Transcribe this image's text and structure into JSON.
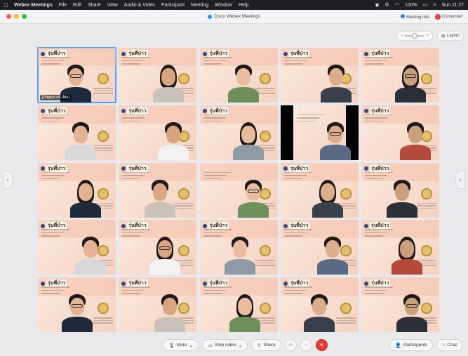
{
  "menubar": {
    "apple": "",
    "app": "Webex Meetings",
    "items": [
      "File",
      "Edit",
      "Share",
      "View",
      "Audio & Video",
      "Participant",
      "Meeting",
      "Window",
      "Help"
    ],
    "battery": "100%",
    "clock": "Sun 11:27"
  },
  "window": {
    "title": "Cisco Webex Meetings",
    "meeting_info": "Meeting Info",
    "connected": "Connected"
  },
  "view": {
    "layout_label": "Layout"
  },
  "tiles": [
    {
      "sticker": "รุ่นพี่ป่าว",
      "label": "[Pnipun #4 (Me)",
      "active": true
    },
    {
      "sticker": "รุ่นพี่ป่าว"
    },
    {
      "sticker": "รุ่นพี่ป่าว"
    },
    {
      "sticker": "รุ่นพี่ป่าว"
    },
    {
      "sticker": "รุ่นพี่ป่าว"
    },
    {
      "sticker": "รุ่นพี่ป่าว"
    },
    {
      "sticker": "รุ่นพี่ป่าว"
    },
    {
      "sticker": "รุ่นพี่ป่าว"
    },
    {
      "sticker": "",
      "black": true
    },
    {
      "sticker": "รุ่นพี่ป่าว"
    },
    {
      "sticker": "รุ่นพี่ป่าว"
    },
    {
      "sticker": "รุ่นพี่ป่าว"
    },
    {
      "sticker": ""
    },
    {
      "sticker": "รุ่นพี่ป่าว"
    },
    {
      "sticker": "รุ่นพี่ป่าว"
    },
    {
      "sticker": "รุ่นพี่ป่าว"
    },
    {
      "sticker": "รุ่นพี่ป่าว"
    },
    {
      "sticker": "รุ่นพี่ป่าว"
    },
    {
      "sticker": "รุ่นพี่ป่าว"
    },
    {
      "sticker": "รุ่นพี่ป่าว"
    },
    {
      "sticker": "รุ่นพี่ป่าว"
    },
    {
      "sticker": "รุ่นพี่ป่าว"
    },
    {
      "sticker": "รุ่นพี่ป่าว"
    },
    {
      "sticker": "รุ่นพี่ป่าว"
    },
    {
      "sticker": "รุ่นพี่ป่าว"
    }
  ],
  "controls": {
    "mute": "Mute",
    "stop_video": "Stop video",
    "share": "Share",
    "participants": "Participants",
    "chat": "Chat"
  },
  "colors": {
    "end_button": "#e53935",
    "active_outline": "#4aa3ff",
    "tile_bg": "#f7dccd"
  }
}
